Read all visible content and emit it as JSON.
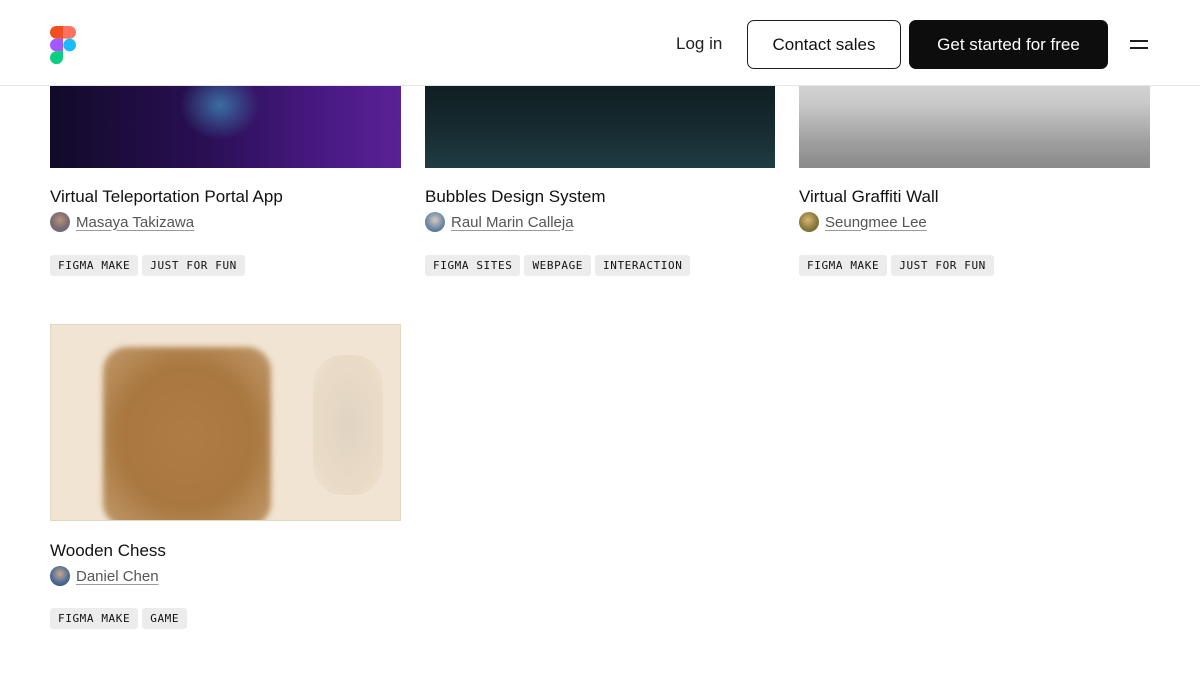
{
  "header": {
    "logo_icon": "figma-logo-icon",
    "login_label": "Log in",
    "contact_label": "Contact sales",
    "get_started_label": "Get started for free",
    "menu_icon": "hamburger-menu-icon"
  },
  "cards": [
    {
      "title": "Virtual Teleportation Portal App",
      "author": "Masaya Takizawa",
      "tags": [
        "FIGMA MAKE",
        "JUST FOR FUN"
      ]
    },
    {
      "title": "Bubbles Design System",
      "author": "Raul Marin Calleja",
      "tags": [
        "FIGMA SITES",
        "WEBPAGE",
        "INTERACTION"
      ]
    },
    {
      "title": "Virtual Graffiti Wall",
      "author": "Seungmee Lee",
      "tags": [
        "FIGMA MAKE",
        "JUST FOR FUN"
      ]
    },
    {
      "title": "Wooden Chess",
      "author": "Daniel Chen",
      "tags": [
        "FIGMA MAKE",
        "GAME"
      ]
    }
  ],
  "colors": {
    "primary_button_bg": "#0d0d0d",
    "tag_bg": "#ececec",
    "text": "#1e1e1e"
  }
}
